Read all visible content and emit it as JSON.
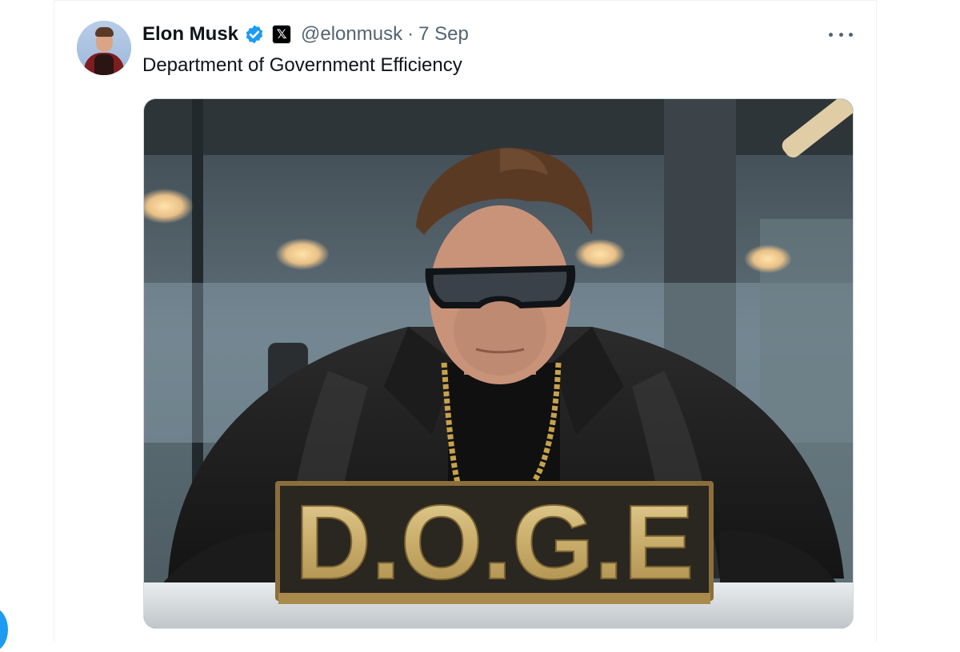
{
  "tweet": {
    "author_name": "Elon Musk",
    "author_handle": "@elonmusk",
    "separator": "·",
    "date": "7 Sep",
    "text": "Department of Government Efficiency",
    "verified_icon": "verified-badge-icon",
    "affiliation_badge_label": "𝕏",
    "more_icon": "more-options-icon"
  },
  "media": {
    "sign_text": "D.O.G.E"
  },
  "colors": {
    "verified_blue": "#1d9bf0",
    "secondary_text": "#536471",
    "primary_text": "#0f1419"
  }
}
